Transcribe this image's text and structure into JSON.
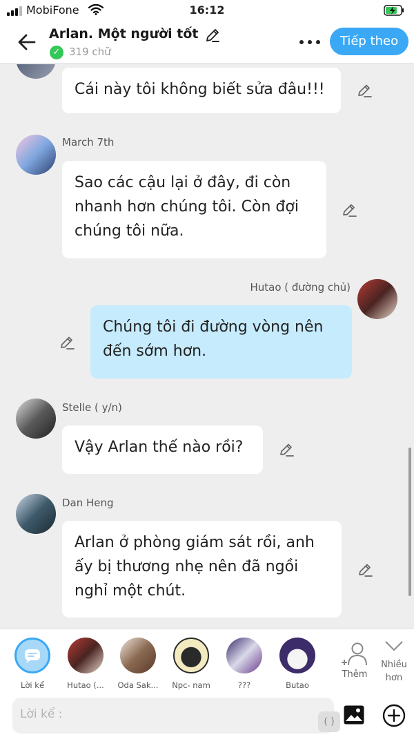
{
  "status_bar": {
    "carrier": "MobiFone",
    "time": "16:12"
  },
  "header": {
    "title": "Arlan. Một người tốt",
    "word_count": "319 chữ",
    "next_button": "Tiếp theo"
  },
  "messages": [
    {
      "text": "Cái này tôi không biết sửa đâu!!!"
    },
    {
      "name": "March 7th",
      "text": "Sao các cậu lại ở đây, đi còn nhanh hơn chúng tôi. Còn đợi chúng tôi nữa."
    },
    {
      "name": "Hutao ( đường chủ)",
      "text": "Chúng tôi đi đường vòng nên đến sớm hơn."
    },
    {
      "name": "Stelle ( y/n)",
      "text": "Vậy Arlan thế nào rồi?"
    },
    {
      "name": "Dan Heng",
      "text": "Arlan ở phòng giám sát rồi, anh ấy bị thương nhẹ nên đã ngồi nghỉ một chút."
    }
  ],
  "characters": [
    {
      "label": "Lời kể"
    },
    {
      "label": "Hutao (..."
    },
    {
      "label": "Oda Sak..."
    },
    {
      "label": "Npc- nam"
    },
    {
      "label": "???"
    },
    {
      "label": "Butao"
    }
  ],
  "actions": {
    "add_label": "Thêm",
    "more_label": "Nhiều hơn"
  },
  "input": {
    "placeholder": "Lời kể :",
    "paren": "( )"
  },
  "colors": {
    "accent": "#3aa8f5",
    "my_bubble": "#c6ebfd",
    "background": "#eeeeee"
  }
}
